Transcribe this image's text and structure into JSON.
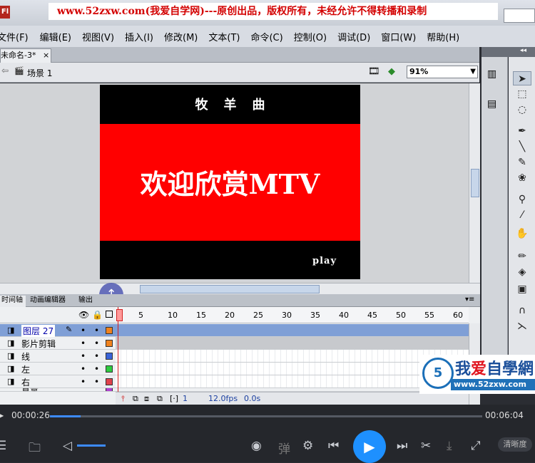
{
  "app": {
    "logo_text": "Fl",
    "banner": "www.52zxw.com(我爱自学网)---原创出品，版权所有，未经允许不得转播和录制"
  },
  "menu": [
    "文件(F)",
    "编辑(E)",
    "视图(V)",
    "插入(I)",
    "修改(M)",
    "文本(T)",
    "命令(C)",
    "控制(O)",
    "调试(D)",
    "窗口(W)",
    "帮助(H)"
  ],
  "document": {
    "tab_label": "未命名-3*",
    "tab_close": "×",
    "scene_label": "场景 1",
    "zoom": "91%"
  },
  "stage": {
    "title": "牧羊曲",
    "welcome": "欢迎欣赏MTV",
    "play_button": "play",
    "background": "#000000",
    "band_color": "#ff0000"
  },
  "panels": {
    "tabs": [
      "时间轴",
      "动画编辑器",
      "输出"
    ]
  },
  "timeline": {
    "ruler": [
      "1",
      "5",
      "10",
      "15",
      "20",
      "25",
      "30",
      "35",
      "40",
      "45",
      "50",
      "55",
      "60"
    ],
    "layers": [
      {
        "name": "图层 27",
        "color": "#f0821e",
        "selected": true
      },
      {
        "name": "影片剪辑",
        "color": "#f0821e",
        "selected": false
      },
      {
        "name": "线",
        "color": "#3a64d8",
        "selected": false
      },
      {
        "name": "左",
        "color": "#2ecc40",
        "selected": false
      },
      {
        "name": "右",
        "color": "#e0414b",
        "selected": false
      },
      {
        "name": "背景",
        "color": "#b040d0",
        "selected": false
      }
    ],
    "current_frame": "1",
    "fps": "12.0fps",
    "time": "0.0s"
  },
  "watermark": {
    "logo": "5",
    "title_pre": "我",
    "title_heart": "爱",
    "title_post": "自學網",
    "url": "www.52zxw.com"
  },
  "player": {
    "current_time": "00:00:26",
    "total_time": "00:06:04",
    "progress": 0.071,
    "danmaku_label": "弹",
    "clarity_label": "清晰度"
  }
}
